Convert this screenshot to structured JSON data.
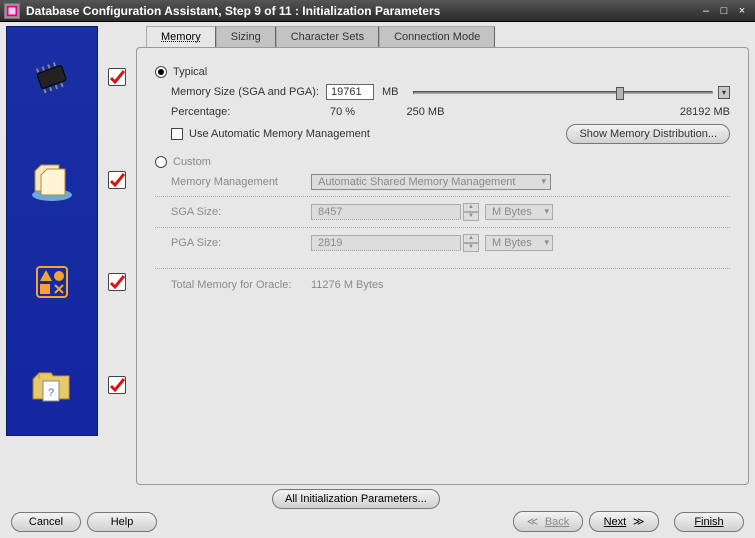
{
  "window": {
    "title": "Database Configuration Assistant, Step 9 of 11 : Initialization Parameters"
  },
  "sidebar": {
    "steps": [
      {
        "icon": "chip-icon",
        "checked": true
      },
      {
        "icon": "folders-icon",
        "checked": true
      },
      {
        "icon": "shapes-icon",
        "checked": true
      },
      {
        "icon": "folder-q-icon",
        "checked": true
      }
    ]
  },
  "tabs": [
    {
      "id": "memory",
      "label": "Memory",
      "active": true
    },
    {
      "id": "sizing",
      "label": "Sizing",
      "active": false
    },
    {
      "id": "charsets",
      "label": "Character Sets",
      "active": false
    },
    {
      "id": "connmode",
      "label": "Connection Mode",
      "active": false
    }
  ],
  "memory": {
    "typical": {
      "radio_label": "Typical",
      "mem_label": "Memory Size (SGA and PGA):",
      "mem_value": "19761",
      "mem_unit": "MB",
      "slider_min_label": "250 MB",
      "slider_max_label": "28192 MB",
      "percentage_label": "Percentage:",
      "percentage_value": "70 %",
      "auto_mm_label": "Use Automatic Memory Management",
      "show_dist_btn": "Show Memory Distribution..."
    },
    "custom": {
      "radio_label": "Custom",
      "mm_label": "Memory Management",
      "mm_value": "Automatic Shared Memory Management",
      "sga_label": "SGA Size:",
      "sga_value": "8457",
      "pga_label": "PGA Size:",
      "pga_value": "2819",
      "unit": "M Bytes",
      "total_label": "Total Memory for Oracle:",
      "total_value": "11276 M Bytes"
    }
  },
  "buttons": {
    "all_params": "All Initialization Parameters...",
    "cancel": "Cancel",
    "help": "Help",
    "back": "Back",
    "next": "Next",
    "finish": "Finish"
  }
}
